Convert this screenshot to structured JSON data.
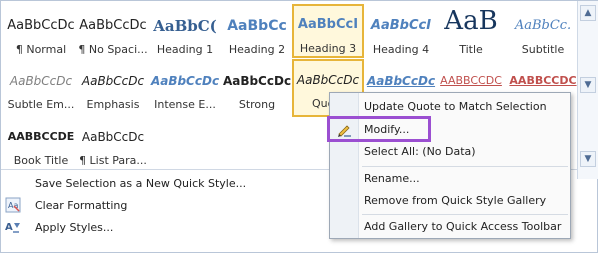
{
  "gallery": {
    "rows": [
      [
        {
          "preview": "AaBbCcDc",
          "name": "¶ Normal"
        },
        {
          "preview": "AaBbCcDc",
          "name": "¶ No Spaci..."
        },
        {
          "preview": "AaBbC(",
          "name": "Heading 1"
        },
        {
          "preview": "AaBbCc",
          "name": "Heading 2"
        },
        {
          "preview": "AaBbCcI",
          "name": "Heading 3",
          "selected": true
        },
        {
          "preview": "AaBbCcI",
          "name": "Heading 4"
        },
        {
          "preview": "AaB",
          "name": "Title"
        },
        {
          "preview": "AaBbCc.",
          "name": "Subtitle"
        }
      ],
      [
        {
          "preview": "AaBbCcDc",
          "name": "Subtle Em..."
        },
        {
          "preview": "AaBbCcDc",
          "name": "Emphasis"
        },
        {
          "preview": "AaBbCcDc",
          "name": "Intense E..."
        },
        {
          "preview": "AaBbCcDc",
          "name": "Strong"
        },
        {
          "preview": "AaBbCcDc",
          "name": "Quo",
          "selected": true
        },
        {
          "preview": "AaBbCcDc",
          "name": ""
        },
        {
          "preview": "AABBCCDC",
          "name": ""
        },
        {
          "preview": "AABBCCDC",
          "name": ""
        }
      ],
      [
        {
          "preview": "AABBCCDE",
          "name": "Book Title"
        },
        {
          "preview": "AaBbCcDc",
          "name": "¶ List Para..."
        }
      ]
    ]
  },
  "commands": [
    {
      "icon": "save-style-icon",
      "label": "Save Selection as a New Quick Style..."
    },
    {
      "icon": "clear-formatting-icon",
      "label": "Clear Formatting"
    },
    {
      "icon": "apply-styles-icon",
      "label": "Apply Styles..."
    }
  ],
  "context_menu": {
    "items": [
      {
        "label": "Update Quote to Match Selection"
      },
      {
        "label": "Modify...",
        "icon": "pencil-icon",
        "highlighted": true
      },
      {
        "label": "Select All: (No Data)"
      },
      {
        "label": "Rename..."
      },
      {
        "label": "Remove from Quick Style Gallery"
      },
      {
        "label": "Add Gallery to Quick Access Toolbar"
      }
    ]
  },
  "colors": {
    "accent": "#e7b53a",
    "highlight_box": "#9b4fd1"
  }
}
